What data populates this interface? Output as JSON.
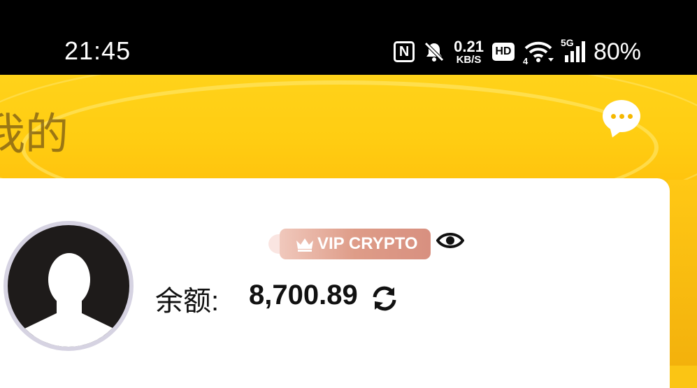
{
  "status_bar": {
    "time": "21:45",
    "net_speed_value": "0.21",
    "net_speed_unit": "KB/S",
    "hd_label": "HD",
    "wifi_sub": "4",
    "cell_tag": "5G",
    "battery": "80%",
    "icons": [
      "nfc-icon",
      "mute-bell-icon",
      "hd-icon",
      "wifi-icon",
      "cell-signal-icon"
    ]
  },
  "header": {
    "title": "我的",
    "message_icon": "chat-bubble-icon"
  },
  "profile": {
    "avatar_icon": "default-avatar-icon",
    "vip_label": "VIP CRYPTO",
    "vip_icon": "crown-icon",
    "visibility_icon": "eye-icon",
    "balance_label": "余额:",
    "balance_value": "8,700.89",
    "refresh_icon": "refresh-icon"
  },
  "colors": {
    "accent_yellow": "#ffcd12",
    "vip_badge": "#de9c88",
    "status_bar_bg": "#000000"
  }
}
